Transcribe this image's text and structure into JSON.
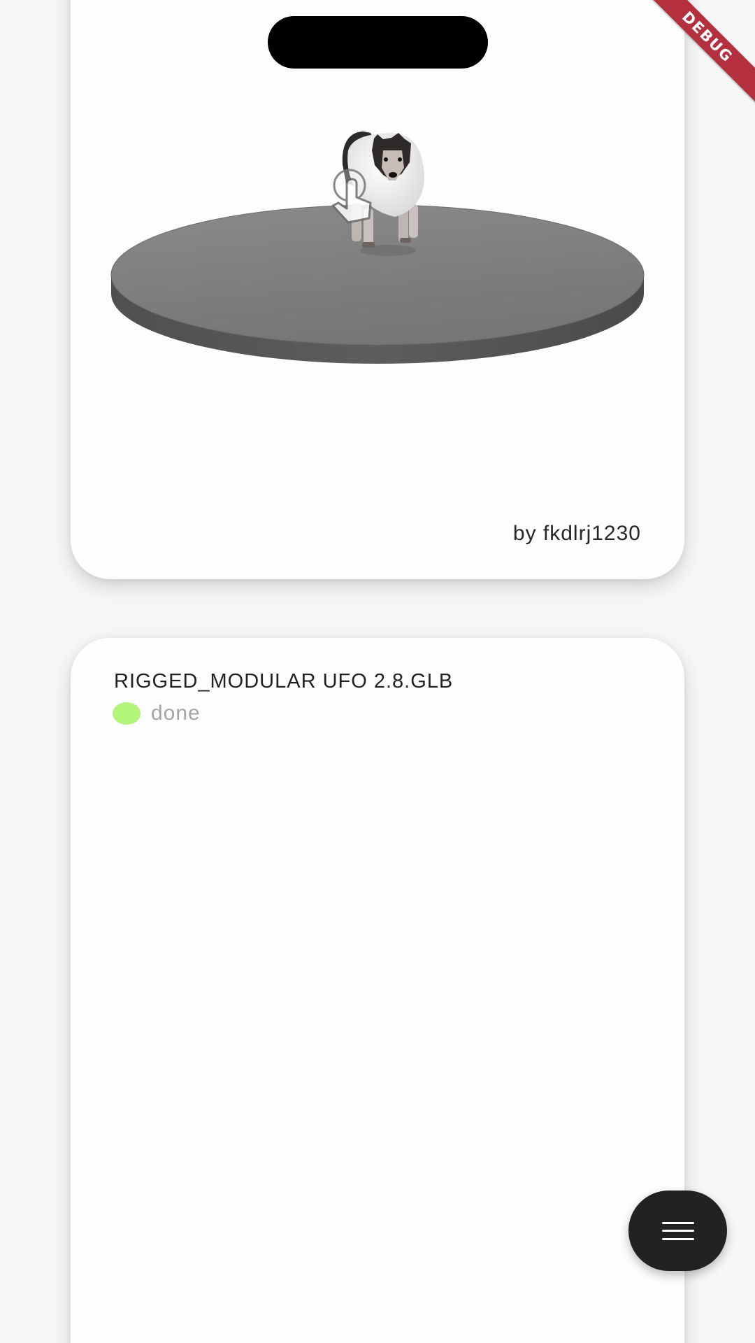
{
  "debug_banner": {
    "label": "DEBUG"
  },
  "viewer_card": {
    "author": "by fkdlrj1230"
  },
  "model_card": {
    "title": "RIGGED_MODULAR UFO 2.8.GLB",
    "status": {
      "label": "done",
      "color": "#b2f57a"
    }
  },
  "fab": {
    "icon": "menu-icon",
    "color": "#222222"
  },
  "icons": {
    "viewer_gesture": "touch-rotate-icon"
  }
}
